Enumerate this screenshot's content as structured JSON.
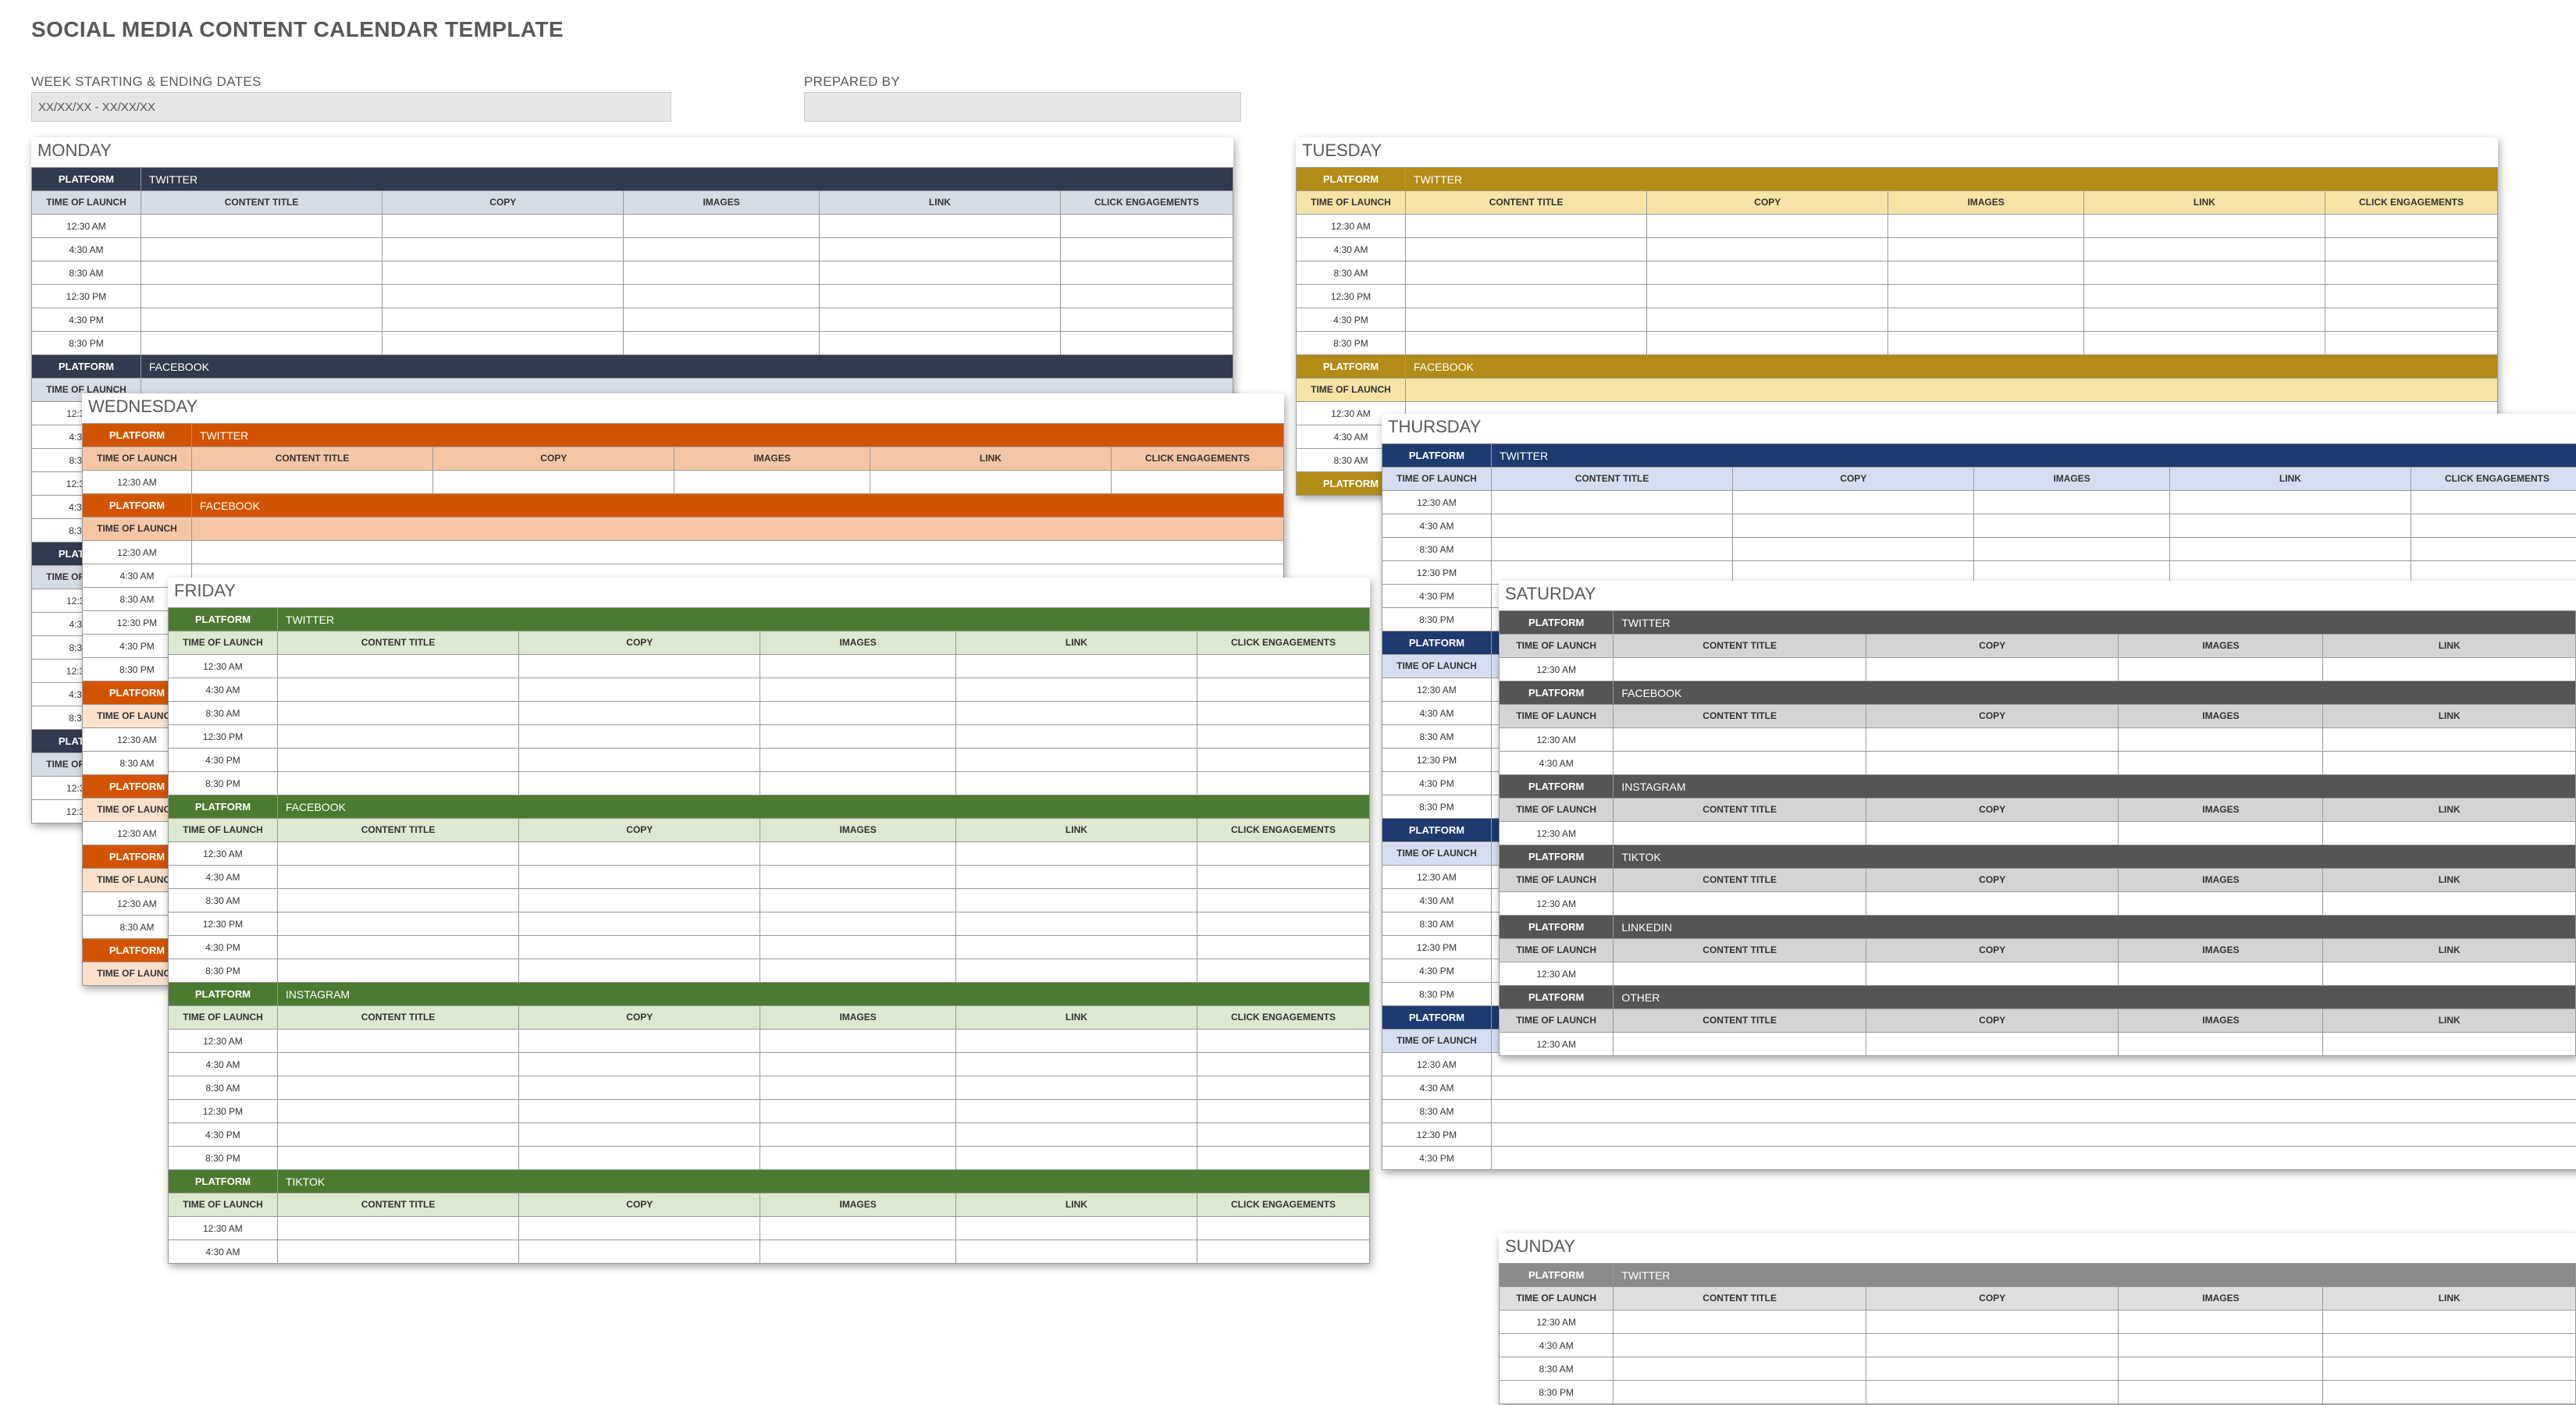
{
  "title": "SOCIAL MEDIA CONTENT CALENDAR TEMPLATE",
  "fields": {
    "dates_label": "WEEK STARTING & ENDING DATES",
    "dates_value": "XX/XX/XX - XX/XX/XX",
    "prepared_label": "PREPARED BY",
    "prepared_value": ""
  },
  "labels": {
    "platform": "PLATFORM",
    "time_of_launch": "TIME OF LAUNCH",
    "content_title": "CONTENT TITLE",
    "copy": "COPY",
    "images": "IMAGES",
    "link": "LINK",
    "click_engagements": "CLICK ENGAGEMENTS"
  },
  "platforms": {
    "twitter": "TWITTER",
    "facebook": "FACEBOOK",
    "instagram": "INSTAGRAM",
    "tiktok": "TIKTOK",
    "linkedin": "LINKEDIN",
    "other": "OTHER"
  },
  "times6": [
    "12:30 AM",
    "4:30 AM",
    "8:30 AM",
    "12:30 PM",
    "4:30 PM",
    "8:30 PM"
  ],
  "times2": [
    "12:30 AM",
    "4:30 AM"
  ],
  "times1": [
    "12:30 AM"
  ],
  "days": {
    "monday": "MONDAY",
    "tuesday": "TUESDAY",
    "wednesday": "WEDNESDAY",
    "thursday": "THURSDAY",
    "friday": "FRIDAY",
    "saturday": "SATURDAY",
    "sunday": "SUNDAY"
  }
}
